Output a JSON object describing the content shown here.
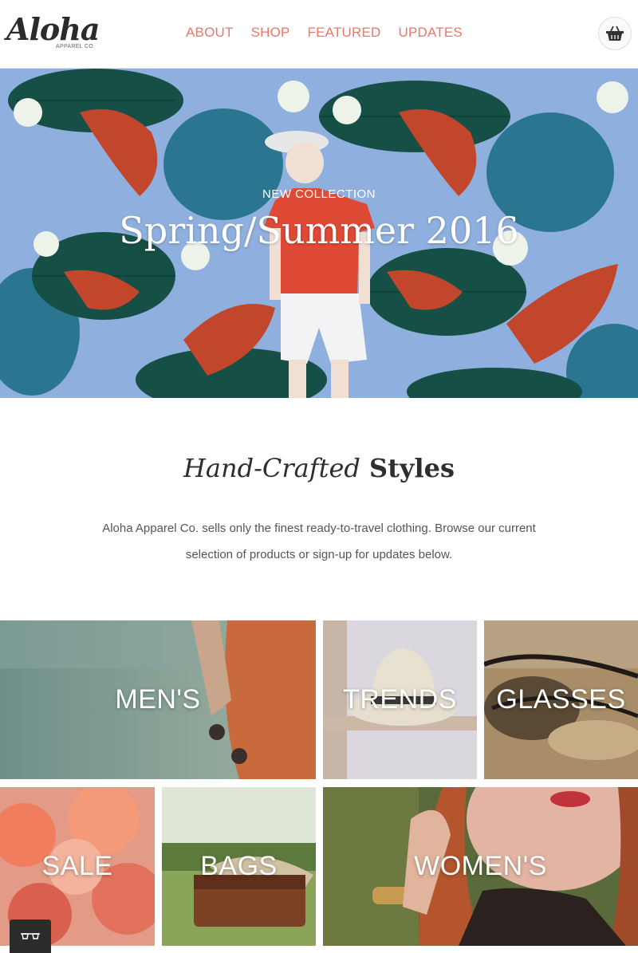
{
  "header": {
    "logo_text": "Aloha",
    "logo_sub": "APPAREL CO",
    "nav": [
      "ABOUT",
      "SHOP",
      "FEATURED",
      "UPDATES"
    ],
    "cart_icon": "basket-icon"
  },
  "hero": {
    "kicker": "NEW COLLECTION",
    "title": "Spring/Summer 2016"
  },
  "intro": {
    "title_em": "Hand-Crafted",
    "title_strong": "Styles",
    "text": "Aloha Apparel Co. sells only the finest ready-to-travel clothing. Browse our current selection of products or sign-up for updates below."
  },
  "tiles": {
    "mens": "MEN'S",
    "trends": "TRENDS",
    "glasses": "GLASSES",
    "sale": "SALE",
    "bags": "BAGS",
    "womens": "WOMEN'S"
  },
  "floating_button_icon": "glasses-icon",
  "colors": {
    "accent": "#e8776a",
    "hero_bg": "#8fb0df",
    "dark": "#2b2b2b"
  }
}
